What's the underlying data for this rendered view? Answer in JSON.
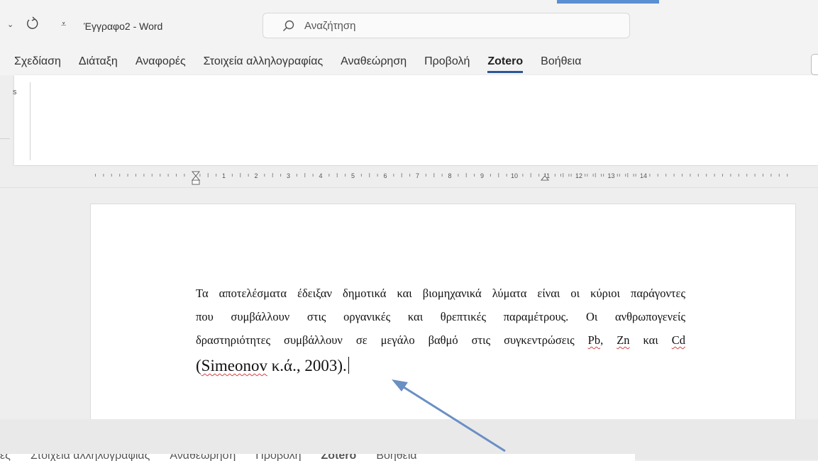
{
  "titlebar": {
    "doc_title": "Έγγραφο2  -  Word",
    "search_placeholder": "Αναζήτηση"
  },
  "ribbon": {
    "tabs": [
      {
        "label": "Σχεδίαση",
        "active": false
      },
      {
        "label": "Διάταξη",
        "active": false
      },
      {
        "label": "Αναφορές",
        "active": false
      },
      {
        "label": "Στοιχεία αλληλογραφίας",
        "active": false
      },
      {
        "label": "Αναθεώρηση",
        "active": false
      },
      {
        "label": "Προβολή",
        "active": false
      },
      {
        "label": "Zotero",
        "active": true
      },
      {
        "label": "Βοήθεια",
        "active": false
      }
    ],
    "left_fragment": "s"
  },
  "ruler": {
    "numbers": [
      "1",
      "2",
      "3",
      "4",
      "5",
      "6",
      "7",
      "8",
      "9",
      "10",
      "11",
      "12",
      "13",
      "14"
    ]
  },
  "document": {
    "lines": [
      "Τα αποτελέσματα έδειξαν δημοτικά και βιομηχανικά λύματα είναι οι κύριοι παράγοντες",
      "που συμβάλλουν στις οργανικές και θρεπτικές παραμέτρους. Οι ανθρωπογενείς"
    ],
    "line3_prefix": "δραστηριότητες συμβάλλουν σε μεγάλο βαθμό στις συγκεντρώσεις ",
    "line3_pb": "Pb",
    "line3_comma": ", ",
    "line3_zn": "Zn",
    "line3_kai": " και ",
    "line3_cd": "Cd",
    "line4_open": "(",
    "line4_author": "Simeonov",
    "line4_rest": " κ.ά., 2003)."
  },
  "bottom_overlay": {
    "ghost_tabs": [
      "ες",
      "Στοιχεία αλληλογραφίας",
      "Αναθεώρηση",
      "Προβολή",
      "Zotero",
      "Βοήθεια"
    ]
  },
  "colors": {
    "accent": "#5b8fd1",
    "tab_underline": "#2b5797",
    "arrow": "#6a8fc4",
    "spell_error": "#d24141"
  }
}
